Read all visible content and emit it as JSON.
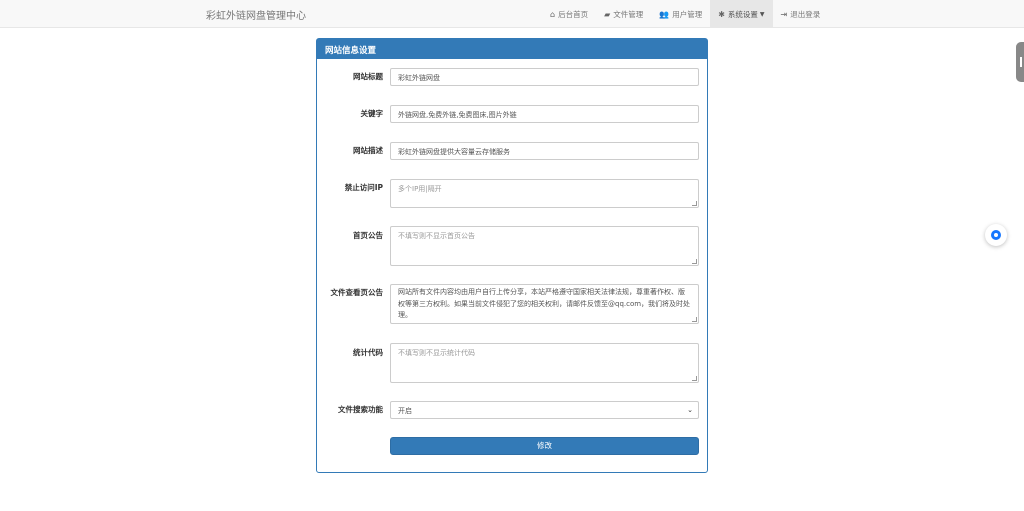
{
  "navbar": {
    "brand": "彩虹外链网盘管理中心",
    "items": [
      {
        "icon": "home-icon",
        "glyph": "⌂",
        "label": "后台首页"
      },
      {
        "icon": "folder-icon",
        "glyph": "▰",
        "label": "文件管理"
      },
      {
        "icon": "users-icon",
        "glyph": "👥",
        "label": "用户管理"
      },
      {
        "icon": "gear-icon",
        "glyph": "✱",
        "label": "系统设置"
      },
      {
        "icon": "logout-icon",
        "glyph": "⇥",
        "label": "退出登录"
      }
    ]
  },
  "panel": {
    "title": "网站信息设置",
    "fields": [
      {
        "label": "网站标题",
        "value": "彩虹外链网盘"
      },
      {
        "label": "关键字",
        "value": "外链网盘,免费外链,免费图床,图片外链"
      },
      {
        "label": "网站描述",
        "value": "彩虹外链网盘提供大容量云存储服务"
      },
      {
        "label": "禁止访问IP",
        "placeholder": "多个IP用|隔开"
      },
      {
        "label": "首页公告",
        "placeholder": "不填写则不显示首页公告"
      },
      {
        "label": "文件查看页公告",
        "value": "网站所有文件内容均由用户自行上传分享，本站严格遵守国家相关法律法规，尊重著作权、版权等第三方权利。如果当前文件侵犯了您的相关权利，请邮件反馈至@qq.com，我们将及时处理。"
      },
      {
        "label": "统计代码",
        "placeholder": "不填写则不显示统计代码"
      },
      {
        "label": "文件搜索功能",
        "value": "开启"
      }
    ],
    "submit_label": "修改"
  },
  "colors": {
    "primary": "#337ab7",
    "navbar_bg": "#f8f8f8",
    "float_icon": "#1677ff"
  }
}
